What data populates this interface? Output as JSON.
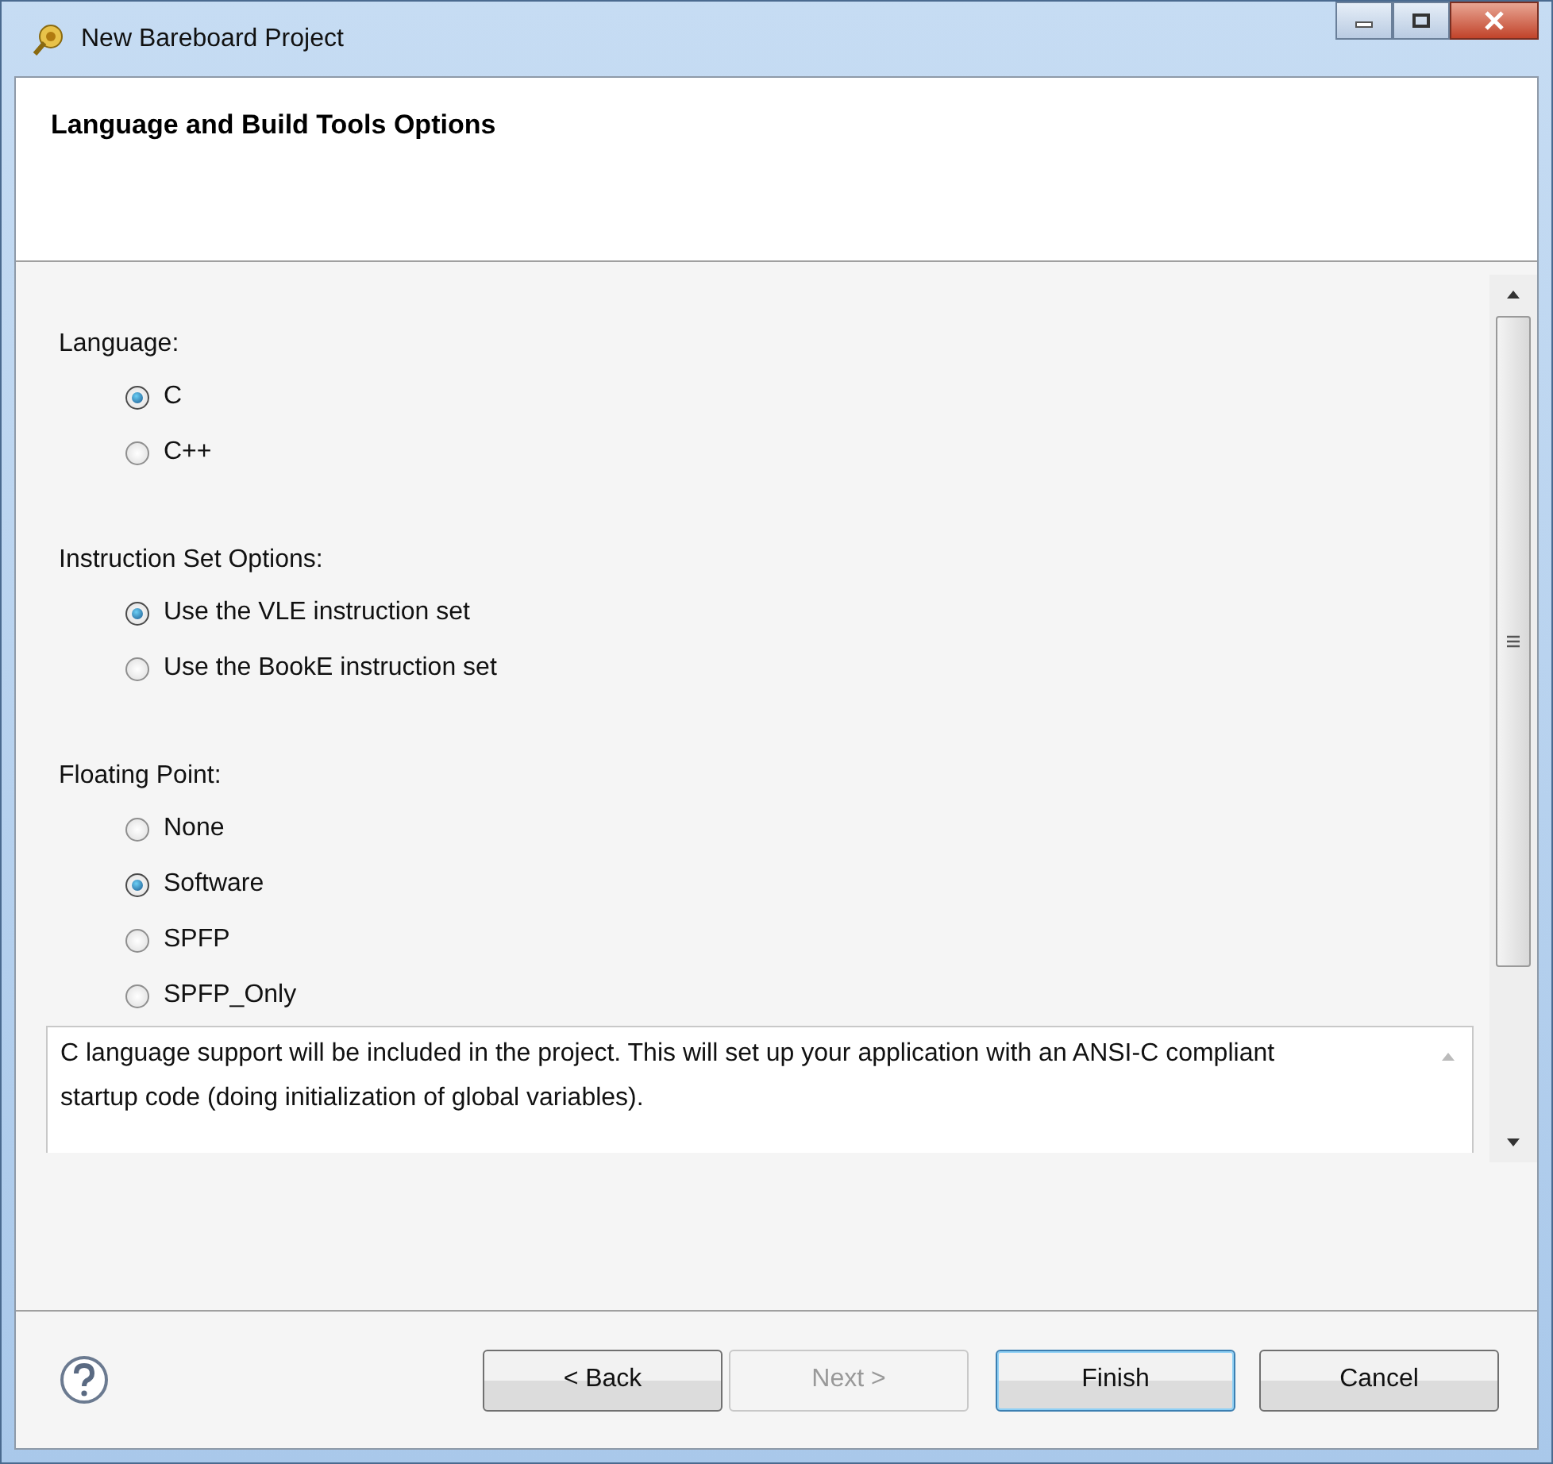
{
  "window": {
    "title": "New Bareboard Project"
  },
  "header": {
    "title": "Language and Build Tools Options"
  },
  "groups": [
    {
      "label": "Language:",
      "options": [
        {
          "label": "C",
          "selected": true
        },
        {
          "label": "C++",
          "selected": false
        }
      ]
    },
    {
      "label": "Instruction Set Options:",
      "options": [
        {
          "label": "Use the VLE instruction set",
          "selected": true
        },
        {
          "label": "Use the BookE instruction set",
          "selected": false
        }
      ]
    },
    {
      "label": "Floating Point:",
      "options": [
        {
          "label": "None",
          "selected": false
        },
        {
          "label": "Software",
          "selected": true
        },
        {
          "label": "SPFP",
          "selected": false
        },
        {
          "label": "SPFP_Only",
          "selected": false
        }
      ]
    }
  ],
  "description": "C language support will be included in the project. This will set up your application with an ANSI-C compliant startup code (doing initialization of global variables).",
  "buttons": [
    {
      "label": "< Back",
      "disabled": false,
      "default": false
    },
    {
      "label": "Next >",
      "disabled": true,
      "default": false
    },
    {
      "label": "Finish",
      "disabled": false,
      "default": true
    },
    {
      "label": "Cancel",
      "disabled": false,
      "default": false
    }
  ]
}
